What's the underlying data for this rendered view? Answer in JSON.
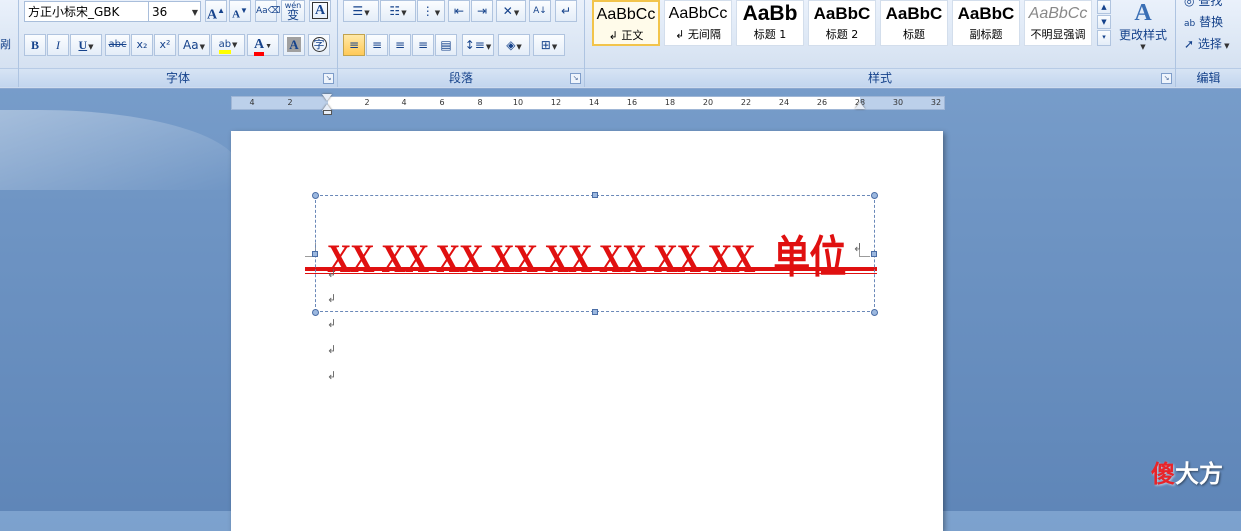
{
  "font_group": {
    "label": "字体",
    "font_name": "方正小标宋_GBK",
    "font_size": "36",
    "grow_font_label": "A",
    "shrink_font_label": "A",
    "phonetic_label": "wén",
    "phonetic_char": "变",
    "border_char_label": "A",
    "bold_label": "B",
    "italic_label": "I",
    "underline_label": "U",
    "strikethrough_label": "abc",
    "subscript_label": "x₂",
    "superscript_label": "x²",
    "change_case_label": "Aa",
    "highlight_label": "ab",
    "font_color_label": "A",
    "char_shading_label": "A",
    "enclose_label": "字"
  },
  "paragraph_group": {
    "label": "段落"
  },
  "styles_group": {
    "label": "样式",
    "change_styles_label": "更改样式",
    "styles": [
      {
        "sample": "AaBbCc",
        "name": "↲ 正文",
        "selected": true
      },
      {
        "sample": "AaBbCc",
        "name": "↲ 无间隔"
      },
      {
        "sample": "AaBb",
        "name": "标题 1"
      },
      {
        "sample": "AaBbC",
        "name": "标题 2"
      },
      {
        "sample": "AaBbC",
        "name": "标题"
      },
      {
        "sample": "AaBbC",
        "name": "副标题"
      },
      {
        "sample": "AaBbCc",
        "name": "不明显强调"
      }
    ]
  },
  "edit_group": {
    "label": "编辑",
    "find_label": "查找",
    "replace_label": "替换",
    "select_label": "选择"
  },
  "left_cut_label": "剐",
  "ruler": {
    "left_numbers": [
      "4",
      "2"
    ],
    "right_numbers": [
      "2",
      "4",
      "6",
      "8",
      "10",
      "12",
      "14",
      "16",
      "18",
      "20",
      "22",
      "24",
      "26",
      "28",
      "30",
      "32"
    ]
  },
  "document": {
    "header_text": "XX XX XX XX XX XX XX XX",
    "header_unit": "单位",
    "paragraph_mark": "↲"
  },
  "watermark": {
    "first": "傻",
    "rest": "大方"
  },
  "colors": {
    "header_red": "#e01010",
    "ribbon_label": "#15428b",
    "highlight_yellow": "#ffff00",
    "font_color_red": "#ff0000"
  }
}
